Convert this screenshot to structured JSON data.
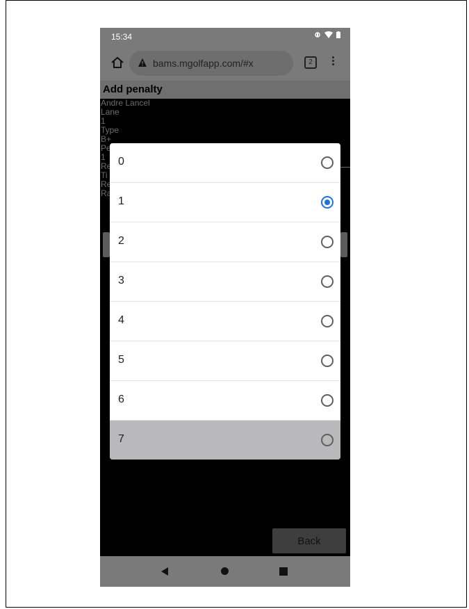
{
  "status_bar": {
    "time": "15:34"
  },
  "browser": {
    "url": "bams.mgolfapp.com/#x",
    "tab_count": "2"
  },
  "page": {
    "title": "Add penalty",
    "background_lines": [
      "Andre Lancel",
      "Lane",
      "1",
      "Type",
      "B+",
      "Pe",
      "1",
      "Re",
      "Ti",
      "Re",
      "Ra"
    ],
    "back_label": "Back"
  },
  "dialog": {
    "selected_value": "1",
    "options": [
      {
        "label": "0",
        "selected": false
      },
      {
        "label": "1",
        "selected": true
      },
      {
        "label": "2",
        "selected": false
      },
      {
        "label": "3",
        "selected": false
      },
      {
        "label": "4",
        "selected": false
      },
      {
        "label": "5",
        "selected": false
      },
      {
        "label": "6",
        "selected": false
      },
      {
        "label": "7",
        "selected": false
      }
    ]
  },
  "colors": {
    "accent": "#1a73e8",
    "highlight_row": "#b9b9bb"
  }
}
